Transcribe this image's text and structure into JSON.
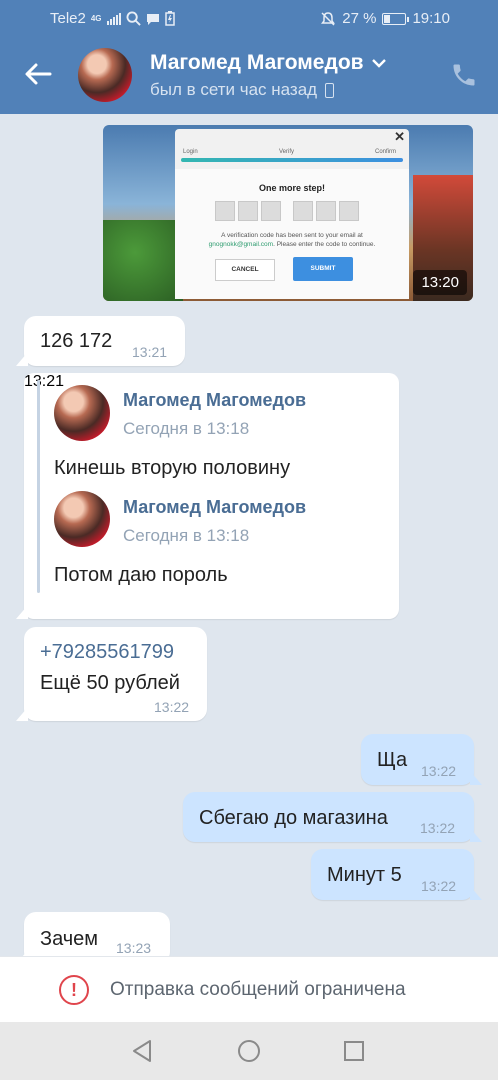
{
  "status_bar": {
    "carrier": "Tele2",
    "network": "4G",
    "battery_percent": "27 %",
    "time": "19:10"
  },
  "header": {
    "contact_name": "Магомед Магомедов",
    "last_seen": "был в сети час назад"
  },
  "screenshot": {
    "steps": [
      "Login",
      "Verify",
      "Confirm"
    ],
    "title": "One more step!",
    "note_line1": "A verification code has been sent to your email at",
    "note_email": "gnognokk@gmail.com",
    "note_line2": ". Please enter the code to continue.",
    "cancel_label": "CANCEL",
    "submit_label": "SUBMIT",
    "time": "13:20"
  },
  "messages": [
    {
      "direction": "in",
      "text": "126 172",
      "time": "13:21"
    },
    {
      "direction": "in",
      "forwarded": [
        {
          "author": "Магомед Магомедов",
          "date": "Сегодня в 13:18",
          "text": "Кинешь вторую половину"
        },
        {
          "author": "Магомед Магомедов",
          "date": "Сегодня в 13:18",
          "text": "Потом даю пороль"
        }
      ],
      "time": "13:21"
    },
    {
      "direction": "in",
      "phone": "+79285561799",
      "text": "Ещё 50 рублей",
      "time": "13:22"
    },
    {
      "direction": "out",
      "text": "Ща",
      "time": "13:22"
    },
    {
      "direction": "out",
      "text": "Сбегаю до магазина",
      "time": "13:22"
    },
    {
      "direction": "out",
      "text": "Минут 5",
      "time": "13:22"
    },
    {
      "direction": "in",
      "text": "Зачем",
      "time": "13:23"
    }
  ],
  "restriction": {
    "text": "Отправка сообщений ограничена"
  },
  "colors": {
    "header": "#5181b8",
    "outgoing_bubble": "#cce4ff",
    "link": "#4a6d94",
    "warning": "#e0454c"
  }
}
